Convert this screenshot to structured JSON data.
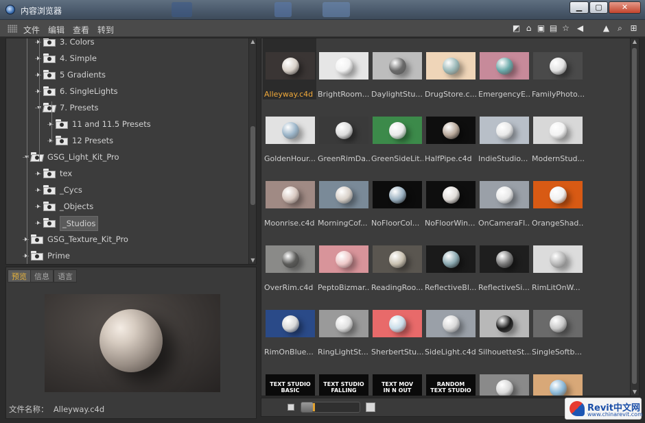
{
  "window": {
    "title": "内容浏览器",
    "controls": [
      "▁",
      "▢",
      "✕"
    ]
  },
  "menu": {
    "items": [
      "文件",
      "编辑",
      "查看",
      "转到"
    ]
  },
  "toolbar": {
    "icons": [
      "frame-icon",
      "home-icon",
      "lock-icon",
      "book-icon",
      "star-icon",
      "back-icon",
      "up-icon",
      "search-icon",
      "add-icon"
    ]
  },
  "tree": {
    "items": [
      {
        "label": "3. Colors",
        "level": 2,
        "type": "closed"
      },
      {
        "label": "4. Simple",
        "level": 2,
        "type": "closed"
      },
      {
        "label": "5 Gradients",
        "level": 2,
        "type": "closed"
      },
      {
        "label": "6. SingleLights",
        "level": 2,
        "type": "closed"
      },
      {
        "label": "7. Presets",
        "level": 2,
        "type": "open"
      },
      {
        "label": "11 and 11.5 Presets",
        "level": 3,
        "type": "closed"
      },
      {
        "label": "12 Presets",
        "level": 3,
        "type": "closed"
      },
      {
        "label": "GSG_Light_Kit_Pro",
        "level": 1,
        "type": "open"
      },
      {
        "label": "tex",
        "level": 2,
        "type": "closed"
      },
      {
        "label": "_Cycs",
        "level": 2,
        "type": "closed"
      },
      {
        "label": "_Objects",
        "level": 2,
        "type": "closed"
      },
      {
        "label": "_Studios",
        "level": 2,
        "type": "closed",
        "selected": true
      },
      {
        "label": "GSG_Texture_Kit_Pro",
        "level": 1,
        "type": "closed"
      },
      {
        "label": "Prime",
        "level": 1,
        "type": "closed"
      }
    ]
  },
  "preview_tabs": [
    {
      "label": "预览",
      "active": true
    },
    {
      "label": "信息",
      "active": false
    },
    {
      "label": "语言",
      "active": false
    }
  ],
  "preview": {
    "filename_label": "文件名称：",
    "filename_value": "Alleyway.c4d"
  },
  "grid": {
    "rows": [
      [
        {
          "caption": "Alleyway.c4d",
          "bg": "#3a3534",
          "ball": "#d8d0c8",
          "selected": true
        },
        {
          "caption": "BrightRoom...",
          "bg": "#e6e6e6",
          "ball": "#f2f2f2"
        },
        {
          "caption": "DaylightStu...",
          "bg": "#bdbdbd",
          "ball": "#6a6a6a"
        },
        {
          "caption": "DrugStore.c...",
          "bg": "#efd5b8",
          "ball": "#9ab8b8"
        },
        {
          "caption": "EmergencyE...",
          "bg": "#c78a9a",
          "ball": "#68a8a8"
        },
        {
          "caption": "FamilyPhoto...",
          "bg": "#4a4a4a",
          "ball": "#e2e2e2"
        }
      ],
      [
        {
          "caption": "GoldenHour...",
          "bg": "#e2e2e2",
          "ball": "#9ab4c8",
          "text": ""
        },
        {
          "caption": "GreenRimDa...",
          "bg": "#3a3a3a",
          "ball": "#dcdcdc"
        },
        {
          "caption": "GreenSideLit...",
          "bg": "#3c8a4a",
          "ball": "#e8e8e8"
        },
        {
          "caption": "HalfPipe.c4d",
          "bg": "#0e0e0e",
          "ball": "#b8a89a"
        },
        {
          "caption": "IndieStudio...",
          "bg": "#b8bfc8",
          "ball": "#e8e8e8"
        },
        {
          "caption": "ModernStud...",
          "bg": "#d8d8d8",
          "ball": "#f2f2f2"
        }
      ],
      [
        {
          "caption": "Moonrise.c4d",
          "bg": "#a08a84",
          "ball": "#d8c8c0"
        },
        {
          "caption": "MorningCof...",
          "bg": "#7a8a98",
          "ball": "#d8d0c8"
        },
        {
          "caption": "NoFloorCol...",
          "bg": "#0c0c0c",
          "ball": "#9ab0c0"
        },
        {
          "caption": "NoFloorWin...",
          "bg": "#0e0e0e",
          "ball": "#e0dcd8"
        },
        {
          "caption": "OnCameraFl...",
          "bg": "#9aa0a8",
          "ball": "#e8e8e8"
        },
        {
          "caption": "OrangeShad...",
          "bg": "#d85a14",
          "ball": "#f0f0f0"
        }
      ],
      [
        {
          "caption": "OverRim.c4d",
          "bg": "#8a8a88",
          "ball": "#5a5a58"
        },
        {
          "caption": "PeptoBizmar...",
          "bg": "#d8949a",
          "ball": "#eec8c8"
        },
        {
          "caption": "ReadingRoo...",
          "bg": "#5a5650",
          "ball": "#c8c0b0"
        },
        {
          "caption": "ReflectiveBl...",
          "bg": "#1a1a1a",
          "ball": "#8aa8b0"
        },
        {
          "caption": "ReflectiveSi...",
          "bg": "#1e1e1e",
          "ball": "#7a7a7a"
        },
        {
          "caption": "RimLitOnW...",
          "bg": "#dcdcdc",
          "ball": "#b8b8b8"
        }
      ],
      [
        {
          "caption": "RimOnBlue...",
          "bg": "#2a4a88",
          "ball": "#d8d8d8"
        },
        {
          "caption": "RingLightSt...",
          "bg": "#9a9a9a",
          "ball": "#e0e0e0"
        },
        {
          "caption": "SherbertStu...",
          "bg": "#e86a6a",
          "ball": "#c8dce8"
        },
        {
          "caption": "SideLight.c4d",
          "bg": "#9aa0a8",
          "ball": "#d8d8d8"
        },
        {
          "caption": "SilhouetteSt...",
          "bg": "#b8b8b8",
          "ball": "#1a1a1a"
        },
        {
          "caption": "SingleSoftb...",
          "bg": "#6a6a6a",
          "ball": "#c8c8c8"
        }
      ],
      [
        {
          "caption": "",
          "bg": "#0a0a0a",
          "ball": "",
          "text": "TEXT STUDIO\nBASIC"
        },
        {
          "caption": "",
          "bg": "#0a0a0a",
          "ball": "",
          "text": "TEXT STUDIO\nFALLING"
        },
        {
          "caption": "",
          "bg": "#0a0a0a",
          "ball": "",
          "text": "TEXT MOV\nIN N OUT"
        },
        {
          "caption": "",
          "bg": "#0a0a0a",
          "ball": "",
          "text": "RANDOM\nTEXT STUDIO"
        },
        {
          "caption": "",
          "bg": "#8a8a8a",
          "ball": "#d8d8d8"
        },
        {
          "caption": "",
          "bg": "#d8a878",
          "ball": "#8ab8d8"
        }
      ]
    ]
  },
  "status": {
    "zoom_fraction": 0.2
  },
  "watermark": {
    "brand": "Revit中文网",
    "url": "www.chinarevit.com"
  }
}
